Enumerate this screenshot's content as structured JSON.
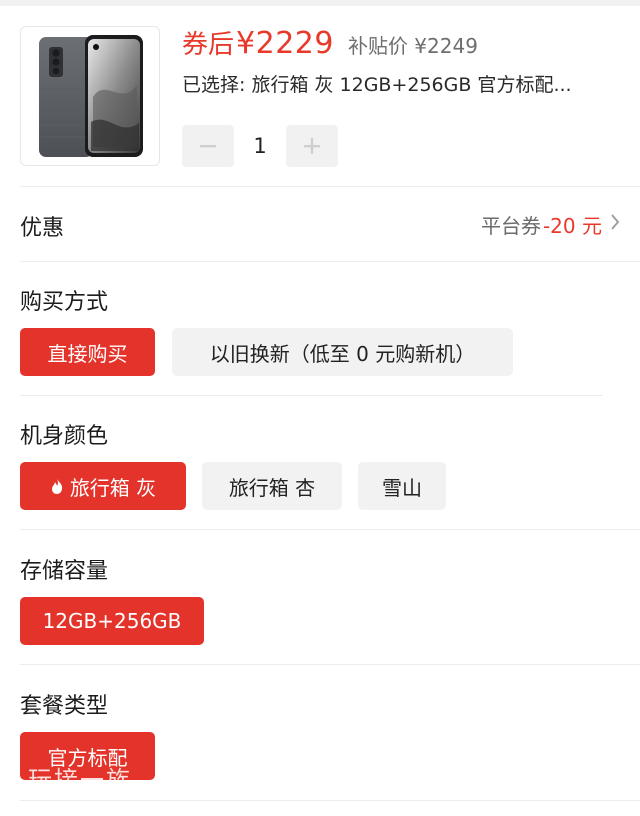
{
  "product": {
    "price_prefix": "券后",
    "price": "¥2229",
    "subsidy_price": "补贴价 ¥2249",
    "selected_summary": "已选择: 旅行箱 灰 12GB+256GB 官方标配...",
    "quantity": "1",
    "image_icon": "phone-image"
  },
  "discount": {
    "label": "优惠",
    "coupon_label": "平台券",
    "coupon_amount": "-20 元"
  },
  "purchase_method": {
    "title": "购买方式",
    "options": [
      "直接购买",
      "以旧换新（低至 0 元购新机）"
    ],
    "selected": 0
  },
  "color": {
    "title": "机身颜色",
    "options": [
      "旅行箱 灰",
      "旅行箱 杏",
      "雪山"
    ],
    "selected": 0
  },
  "storage": {
    "title": "存储容量",
    "options": [
      "12GB+256GB"
    ],
    "selected": 0
  },
  "package": {
    "title": "套餐类型",
    "options": [
      "官方标配"
    ],
    "selected": 0
  },
  "watermark": "玩接一族",
  "colors": {
    "accent": "#e3332a",
    "price": "#e8392b",
    "chip_bg": "#f2f2f2",
    "divider": "#ececec"
  }
}
